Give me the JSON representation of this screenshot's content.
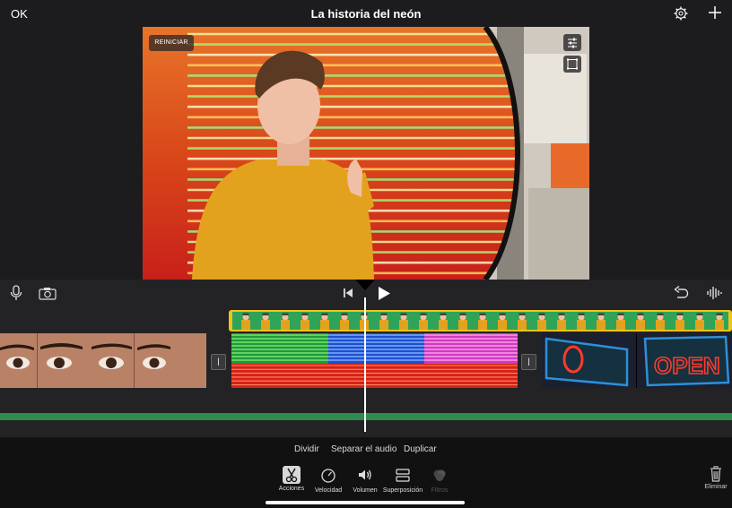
{
  "topbar": {
    "ok_label": "OK",
    "title": "La historia del neón"
  },
  "viewer": {
    "reset_label": "REINICIAR"
  },
  "bottom": {
    "actions": [
      "Dividir",
      "Separar el audio",
      "Duplicar"
    ],
    "tools": [
      {
        "label": "Acciones",
        "icon": "scissors-icon",
        "selected": true
      },
      {
        "label": "Velocidad",
        "icon": "speedometer-icon"
      },
      {
        "label": "Volumen",
        "icon": "speaker-icon"
      },
      {
        "label": "Superposición",
        "icon": "overlay-icon"
      },
      {
        "label": "Filtros",
        "icon": "filters-icon",
        "disabled": true
      }
    ],
    "delete_label": "Eliminar"
  },
  "colors": {
    "accent_yellow": "#f0c419",
    "track_green": "#2e8b4e",
    "background": "#1c1c1e"
  }
}
